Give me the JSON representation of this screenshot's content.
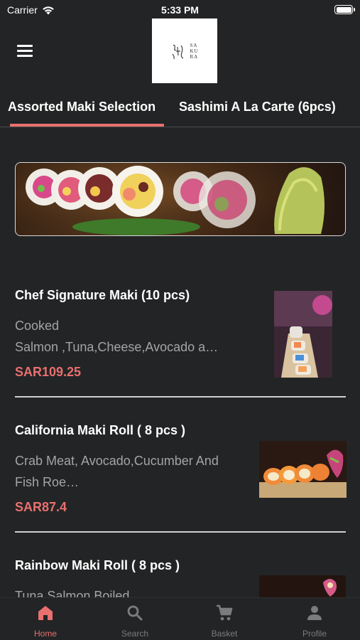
{
  "status_bar": {
    "carrier": "Carrier",
    "time": "5:33 PM",
    "battery": 1.0
  },
  "header": {
    "menu_icon": "hamburger-menu-icon",
    "logo_lines": [
      "SA",
      "KU",
      "RA"
    ]
  },
  "category_tabs": [
    {
      "label": "Assorted Maki Selection",
      "selected": true
    },
    {
      "label": "Sashimi A La Carte  (6pcs)",
      "selected": false
    }
  ],
  "menu_items": [
    {
      "name": "Chef Signature Maki (10 pcs)",
      "description": [
        "Cooked",
        "Salmon ,Tuna,Cheese,Avocado a…"
      ],
      "price": "SAR109.25"
    },
    {
      "name": "California Maki Roll ( 8 pcs )",
      "description": [
        "Crab Meat, Avocado,Cucumber And",
        "Fish Roe…"
      ],
      "price": "SAR87.4"
    },
    {
      "name": "Rainbow Maki Roll ( 8 pcs )",
      "description": [
        "Tuna Salmon Boiled"
      ],
      "price": ""
    }
  ],
  "bottom_nav": [
    {
      "label": "Home",
      "icon": "home-icon",
      "active": true
    },
    {
      "label": "Search",
      "icon": "search-icon",
      "active": false
    },
    {
      "label": "Basket",
      "icon": "cart-icon",
      "active": false
    },
    {
      "label": "Profile",
      "icon": "profile-icon",
      "active": false
    }
  ],
  "colors": {
    "background": "#232425",
    "accent": "#e8706f",
    "muted_text": "#a3a4a6",
    "nav_inactive": "#7b7c7e"
  }
}
